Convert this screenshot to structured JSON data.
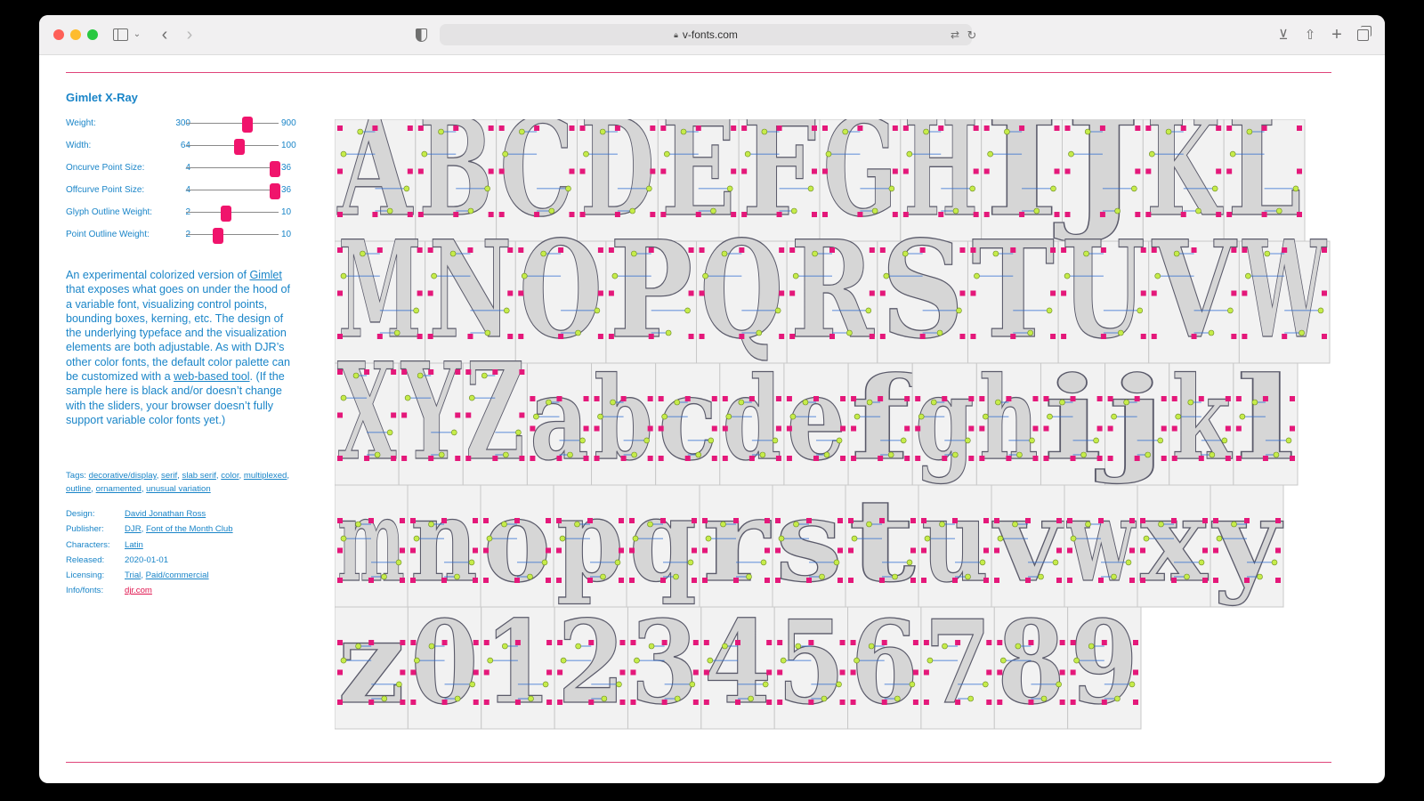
{
  "browser": {
    "url": "v-fonts.com"
  },
  "font": {
    "name": "Gimlet X-Ray"
  },
  "controls": [
    {
      "label": "Weight:",
      "min": "300",
      "max": "900",
      "value": 0.66
    },
    {
      "label": "Width:",
      "min": "64",
      "max": "100",
      "value": 0.58
    },
    {
      "label": "Oncurve Point Size:",
      "min": "4",
      "max": "36",
      "value": 0.96
    },
    {
      "label": "Offcurve Point Size:",
      "min": "4",
      "max": "36",
      "value": 0.96
    },
    {
      "label": "Glyph Outline Weight:",
      "min": "2",
      "max": "10",
      "value": 0.43
    },
    {
      "label": "Point Outline Weight:",
      "min": "2",
      "max": "10",
      "value": 0.35
    }
  ],
  "description": {
    "part1": "An experimental colorized version of ",
    "link1": "Gimlet",
    "part2": " that exposes what goes on under the hood of a variable font, visualizing control points, bounding boxes, kerning, etc. The design of the underlying typeface and the visualization elements are both adjustable. As with DJR’s other color fonts, the default color palette can be customized with a ",
    "link2": "web-based tool",
    "part3": ". (If the sample here is black and/or doesn’t change with the sliders, your browser doesn’t fully support variable color fonts yet.)"
  },
  "tags": {
    "label": "Tags:",
    "items": [
      "decorative/display",
      "serif",
      "slab serif",
      "color",
      "multiplexed",
      "outline",
      "ornamented",
      "unusual variation"
    ]
  },
  "meta": [
    {
      "key": "Design:",
      "values": [
        "David Jonathan Ross"
      ]
    },
    {
      "key": "Publisher:",
      "values": [
        "DJR",
        "Font of the Month Club"
      ]
    },
    {
      "key": "Characters:",
      "values": [
        "Latin"
      ]
    },
    {
      "key": "Released:",
      "values": [
        "2020-01-01"
      ],
      "plain": true
    },
    {
      "key": "Licensing:",
      "values": [
        "Trial",
        "Paid/commercial"
      ]
    },
    {
      "key": "Info/fonts:",
      "values": [
        "djr.com"
      ],
      "red": true
    }
  ],
  "specimen": {
    "rows": [
      [
        "A",
        "B",
        "C",
        "D",
        "E",
        "F",
        "G",
        "H",
        "I",
        "J",
        "K",
        "L"
      ],
      [
        "M",
        "N",
        "O",
        "P",
        "Q",
        "R",
        "S",
        "T",
        "U",
        "V",
        "W"
      ],
      [
        "X",
        "Y",
        "Z",
        "a",
        "b",
        "c",
        "d",
        "e",
        "f",
        "g",
        "h",
        "i",
        "j",
        "k",
        "l"
      ],
      [
        "m",
        "n",
        "o",
        "p",
        "q",
        "r",
        "s",
        "t",
        "u",
        "v",
        "w",
        "x",
        "y"
      ],
      [
        "z",
        "0",
        "1",
        "2",
        "3",
        "4",
        "5",
        "6",
        "7",
        "8",
        "9"
      ]
    ],
    "colors": {
      "cell_fill": "#f2f2f2",
      "cell_border": "#c8c8c8",
      "glyph_fill": "#d6d6d6",
      "glyph_outline": "#5a5a6a",
      "oncurve_point": "#e4187a",
      "offcurve_point": "#c6ec4a",
      "handle_line": "#2a6ad0"
    }
  }
}
